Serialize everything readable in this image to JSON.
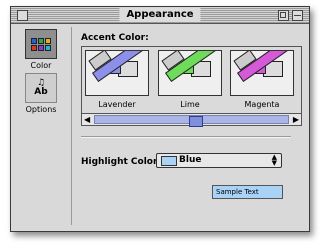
{
  "window": {
    "title": "Appearance"
  },
  "sidebar": {
    "items": [
      {
        "label": "Color",
        "icon": "color-grid-icon",
        "selected": true
      },
      {
        "label": "Options",
        "icon": "options-icon",
        "selected": false
      }
    ]
  },
  "accent": {
    "label": "Accent Color:",
    "themes": [
      {
        "name": "Lavender",
        "color": "#8c90e8"
      },
      {
        "name": "Lime",
        "color": "#6edc5a"
      },
      {
        "name": "Magenta",
        "color": "#d45ad8"
      }
    ]
  },
  "highlight": {
    "label": "Highlight Color:",
    "value": "Blue",
    "swatch_color": "#a9d2f6",
    "sample_text": "Sample Text"
  },
  "colors": {
    "window_bg": "#d9d9d9",
    "sample_bg": "#a9d2f6",
    "scroll_thumb": "#7f8fdc"
  }
}
